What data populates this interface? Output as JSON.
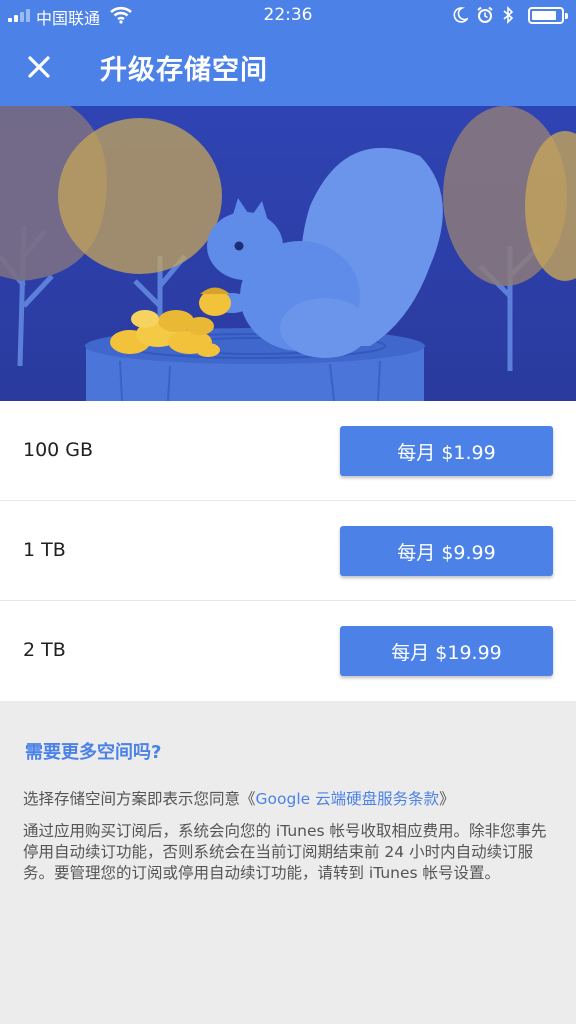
{
  "status_bar": {
    "carrier": "中国联通",
    "time": "22:36",
    "icons": [
      "signal-icon",
      "wifi-icon",
      "moon-icon",
      "alarm-icon",
      "bluetooth-icon",
      "battery-icon"
    ]
  },
  "app_bar": {
    "close_icon": "close-icon",
    "title": "升级存储空间"
  },
  "banner": {
    "illustration": "squirrel-with-acorns-on-tree-stump"
  },
  "plans": [
    {
      "size": "100 GB",
      "price_label": "每月 $1.99"
    },
    {
      "size": "1 TB",
      "price_label": "每月 $9.99"
    },
    {
      "size": "2 TB",
      "price_label": "每月 $19.99"
    }
  ],
  "footer": {
    "more_space_link": "需要更多空间吗?",
    "agree_prefix": "选择存储空间方案即表示您同意《",
    "terms_link": "Google 云端硬盘服务条款",
    "agree_suffix": "》",
    "itunes_notice": "通过应用购买订阅后，系统会向您的 iTunes 帐号收取相应费用。除非您事先停用自动续订功能，否则系统会在当前订阅期结束前 24 小时内自动续订服务。要管理您的订阅或停用自动续订功能，请转到 iTunes 帐号设置。"
  },
  "colors": {
    "brand_blue": "#4c82e8",
    "banner_bg": "#2d3fa7",
    "page_bg": "#ececec"
  }
}
